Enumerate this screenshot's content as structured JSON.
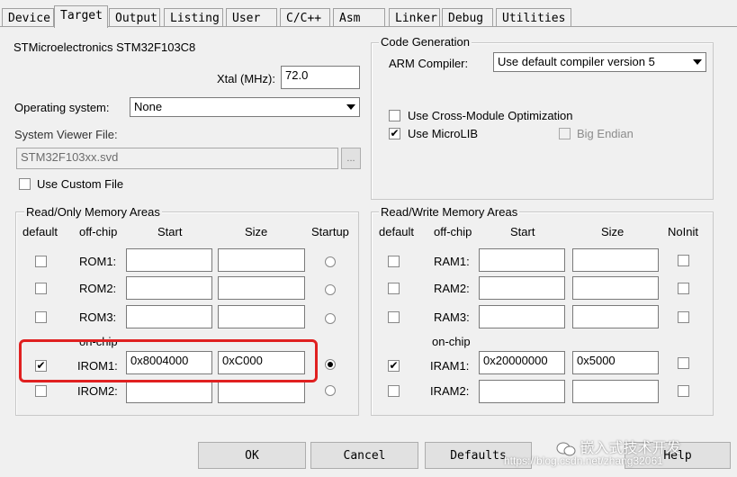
{
  "tabs": [
    {
      "label": "Device",
      "active": false
    },
    {
      "label": "Target",
      "active": true
    },
    {
      "label": "Output",
      "active": false
    },
    {
      "label": "Listing",
      "active": false
    },
    {
      "label": "User",
      "active": false
    },
    {
      "label": "C/C++",
      "active": false
    },
    {
      "label": "Asm",
      "active": false
    },
    {
      "label": "Linker",
      "active": false
    },
    {
      "label": "Debug",
      "active": false
    },
    {
      "label": "Utilities",
      "active": false
    }
  ],
  "device_name": "STMicroelectronics STM32F103C8",
  "xtal": {
    "label": "Xtal (MHz):",
    "value": "72.0"
  },
  "os": {
    "label": "Operating system:",
    "value": "None"
  },
  "svd": {
    "label": "System Viewer File:",
    "value": "STM32F103xx.svd",
    "browse_label": "..."
  },
  "use_custom_file": {
    "label": "Use Custom File",
    "checked": false
  },
  "code_gen": {
    "title": "Code Generation",
    "compiler_label": "ARM Compiler:",
    "compiler_value": "Use default compiler version 5",
    "cross_module": {
      "label": "Use Cross-Module Optimization",
      "checked": false
    },
    "microlib": {
      "label": "Use MicroLIB",
      "checked": true
    },
    "big_endian": {
      "label": "Big Endian",
      "checked": false
    }
  },
  "ro_mem": {
    "title": "Read/Only Memory Areas",
    "headers": {
      "default": "default",
      "offchip": "off-chip",
      "start": "Start",
      "size": "Size",
      "startup": "Startup"
    },
    "onchip_label": "on-chip",
    "rows": [
      {
        "name": "ROM1:",
        "default": false,
        "start": "",
        "size": "",
        "startup": false
      },
      {
        "name": "ROM2:",
        "default": false,
        "start": "",
        "size": "",
        "startup": false
      },
      {
        "name": "ROM3:",
        "default": false,
        "start": "",
        "size": "",
        "startup": false
      },
      {
        "name": "IROM1:",
        "default": true,
        "start": "0x8004000",
        "size": "0xC000",
        "startup": true
      },
      {
        "name": "IROM2:",
        "default": false,
        "start": "",
        "size": "",
        "startup": false
      }
    ]
  },
  "rw_mem": {
    "title": "Read/Write Memory Areas",
    "headers": {
      "default": "default",
      "offchip": "off-chip",
      "start": "Start",
      "size": "Size",
      "noinit": "NoInit"
    },
    "onchip_label": "on-chip",
    "rows": [
      {
        "name": "RAM1:",
        "default": false,
        "start": "",
        "size": "",
        "noinit": false
      },
      {
        "name": "RAM2:",
        "default": false,
        "start": "",
        "size": "",
        "noinit": false
      },
      {
        "name": "RAM3:",
        "default": false,
        "start": "",
        "size": "",
        "noinit": false
      },
      {
        "name": "IRAM1:",
        "default": true,
        "start": "0x20000000",
        "size": "0x5000",
        "noinit": false
      },
      {
        "name": "IRAM2:",
        "default": false,
        "start": "",
        "size": "",
        "noinit": false
      }
    ]
  },
  "buttons": {
    "ok": "OK",
    "cancel": "Cancel",
    "defaults": "Defaults",
    "help": "Help"
  },
  "watermark": {
    "brand": "嵌入式技术开发",
    "url": "https://blog.csdn.net/zhang32061"
  },
  "colors": {
    "highlight": "#e02020"
  }
}
